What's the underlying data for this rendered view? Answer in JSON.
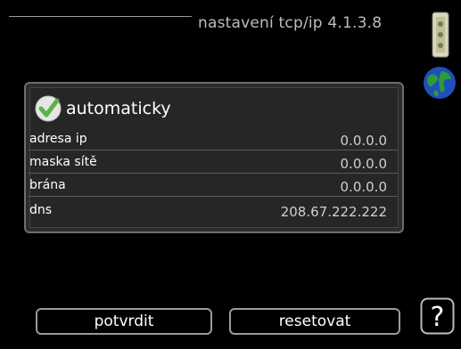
{
  "header": {
    "title": "nastavení tcp/ip 4.1.3.8"
  },
  "icons": {
    "scroll": "scrollbar-icon",
    "globe": "globe-icon",
    "help": "help-icon",
    "check": "check-icon"
  },
  "settings": {
    "auto_label": "automaticky",
    "auto_checked": true,
    "rows": [
      {
        "label": "adresa ip",
        "value": "0.0.0.0"
      },
      {
        "label": "maska sítě",
        "value": "0.0.0.0"
      },
      {
        "label": "brána",
        "value": "0.0.0.0"
      },
      {
        "label": "dns",
        "value": "208.67.222.222"
      }
    ]
  },
  "buttons": {
    "confirm": "potvrdit",
    "reset": "resetovat"
  },
  "help": {
    "symbol": "?"
  },
  "colors": {
    "background": "#000000",
    "panel": "#2c2c2c",
    "check_green": "#5fb14a",
    "globe_blue": "#1f4fb8",
    "globe_green": "#2f9a3a"
  }
}
